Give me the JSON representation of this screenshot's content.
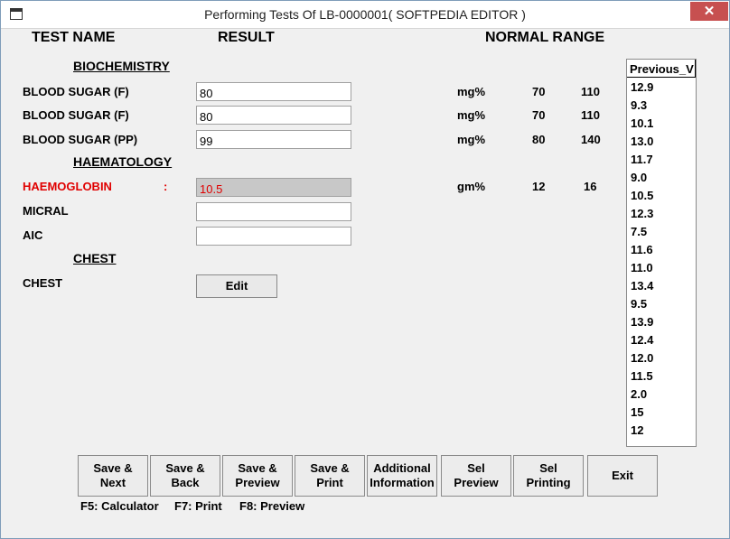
{
  "window": {
    "title": "Performing Tests Of LB-0000001( SOFTPEDIA EDITOR )",
    "close_glyph": "✕"
  },
  "headers": {
    "test_name": "TEST NAME",
    "result": "RESULT",
    "normal_range": "NORMAL RANGE"
  },
  "sections": {
    "biochemistry": "BIOCHEMISTRY",
    "haematology": "HAEMATOLOGY",
    "chest": "CHEST"
  },
  "tests": [
    {
      "name": "BLOOD SUGAR (F)",
      "value": "80",
      "unit": "mg%",
      "low": "70",
      "high": "110"
    },
    {
      "name": "BLOOD SUGAR (F)",
      "value": "80",
      "unit": "mg%",
      "low": "70",
      "high": "110"
    },
    {
      "name": "BLOOD SUGAR (PP)",
      "value": "99",
      "unit": "mg%",
      "low": "80",
      "high": "140"
    },
    {
      "name": "HAEMOGLOBIN",
      "colon": ":",
      "value": "10.5",
      "unit": "gm%",
      "low": "12",
      "high": "16"
    },
    {
      "name": "MICRAL",
      "value": ""
    },
    {
      "name": "AIC",
      "value": ""
    },
    {
      "name": "CHEST"
    }
  ],
  "edit_button": "Edit",
  "previous": {
    "header": "Previous_V",
    "values": [
      "12.9",
      "9.3",
      "10.1",
      "13.0",
      "11.7",
      "9.0",
      "10.5",
      "12.3",
      "7.5",
      "11.6",
      "11.0",
      "13.4",
      "9.5",
      "13.9",
      "12.4",
      "12.0",
      "11.5",
      "2.0",
      "15",
      "12"
    ]
  },
  "buttons": [
    {
      "line1": "Save &",
      "line2": "Next"
    },
    {
      "line1": "Save &",
      "line2": "Back"
    },
    {
      "line1": "Save &",
      "line2": "Preview"
    },
    {
      "line1": "Save &",
      "line2": "Print"
    },
    {
      "line1": "Additional",
      "line2": "Information"
    },
    {
      "line1": "Sel",
      "line2": "Preview"
    },
    {
      "line1": "Sel",
      "line2": "Printing"
    },
    {
      "line1": "Exit",
      "line2": ""
    }
  ],
  "shortcuts": {
    "calc": "F5: Calculator",
    "print": "F7: Print",
    "preview": "F8: Preview"
  },
  "colors": {
    "abnormal": "#e00000",
    "close_button": "#c75050"
  }
}
